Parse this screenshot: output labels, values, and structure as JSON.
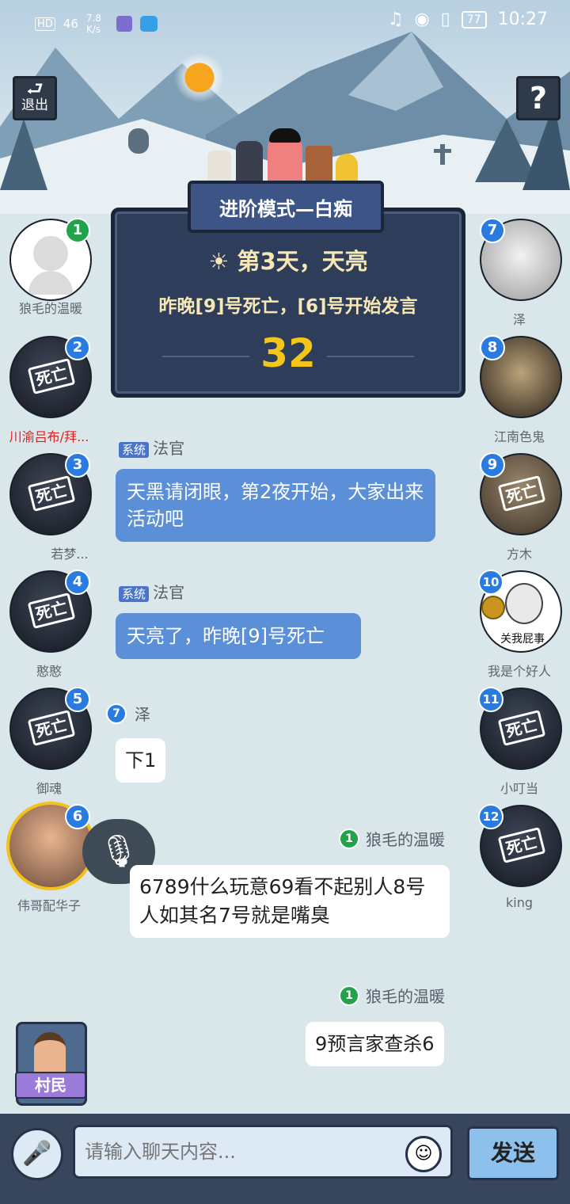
{
  "status_bar": {
    "left": [
      "HD",
      "46",
      "7.8 K/s"
    ],
    "battery": "77",
    "time": "10:27"
  },
  "buttons": {
    "exit": "退出",
    "help": "?",
    "send": "发送"
  },
  "game": {
    "mode": "进阶模式—白痴",
    "day": "第3天，天亮",
    "info": "昨晚[9]号死亡，[6]号开始发言",
    "countdown": "32"
  },
  "dead_stamp": "死亡",
  "players_left": [
    {
      "num": "1",
      "name": "狼毛的温暖",
      "dead": false
    },
    {
      "num": "2",
      "name": "川渝吕布/拜...",
      "dead": true
    },
    {
      "num": "3",
      "name": "若梦...",
      "dead": true
    },
    {
      "num": "4",
      "name": "憨憨",
      "dead": true
    },
    {
      "num": "5",
      "name": "御魂",
      "dead": true
    },
    {
      "num": "6",
      "name": "伟哥配华子",
      "dead": false
    }
  ],
  "players_right": [
    {
      "num": "7",
      "name": "泽",
      "dead": false
    },
    {
      "num": "8",
      "name": "江南色鬼",
      "dead": false
    },
    {
      "num": "9",
      "name": "方木",
      "dead": true
    },
    {
      "num": "10",
      "name": "我是个好人",
      "dead": false,
      "avatar_caption": "关我屁事"
    },
    {
      "num": "11",
      "name": "小叮当",
      "dead": true
    },
    {
      "num": "12",
      "name": "king",
      "dead": true
    }
  ],
  "chat": [
    {
      "tag": "系统",
      "sender": "法官",
      "text": "天黑请闭眼，第2夜开始，大家出来活动吧"
    },
    {
      "tag": "系统",
      "sender": "法官",
      "text": "天亮了，昨晚[9]号死亡"
    },
    {
      "num": "7",
      "sender": "泽",
      "text": "下1"
    },
    {
      "num": "1",
      "sender": "狼毛的温暖",
      "text": "6789什么玩意69看不起别人8号人如其名7号就是嘴臭"
    },
    {
      "num": "1",
      "sender": "狼毛的温暖",
      "text": "9预言家查杀6"
    }
  ],
  "role": {
    "label": "村民"
  },
  "input": {
    "placeholder": "请输入聊天内容..."
  },
  "colors": {
    "accent": "#2a7be0",
    "panel": "#2e3e5a",
    "countdown": "#f5c518",
    "danger_name": "#e02020"
  }
}
